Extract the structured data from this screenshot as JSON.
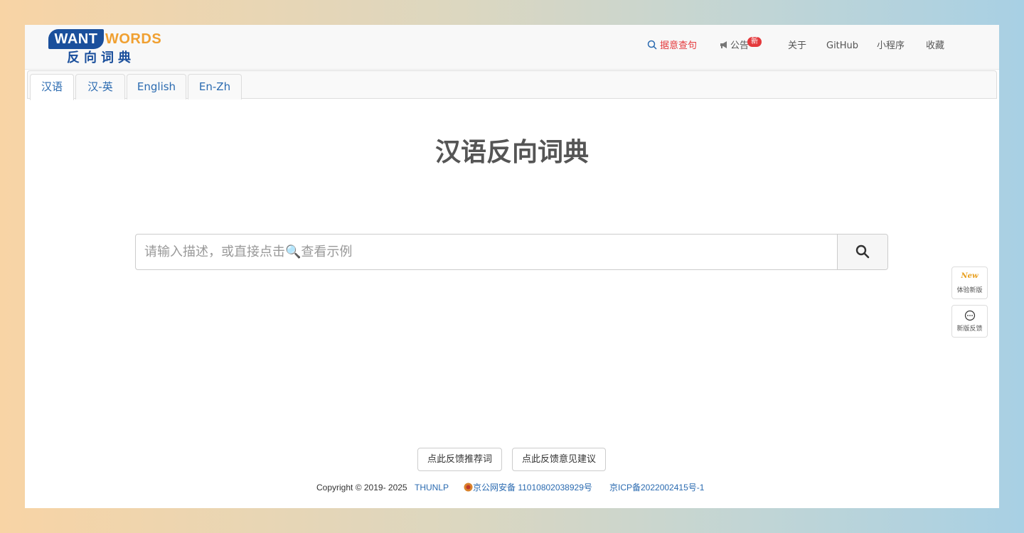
{
  "logo": {
    "want": "WANT",
    "words": "WORDS",
    "cn": "反向词典"
  },
  "nav": {
    "search_label": "据意查句",
    "announce_label": "公告",
    "announce_badge": "新",
    "about": "关于",
    "github": "GitHub",
    "miniprogram": "小程序",
    "favorite": "收藏"
  },
  "tabs": [
    {
      "label": "汉语",
      "active": true
    },
    {
      "label": "汉-英",
      "active": false
    },
    {
      "label": "English",
      "active": false
    },
    {
      "label": "En-Zh",
      "active": false
    }
  ],
  "main": {
    "title": "汉语反向词典",
    "search_placeholder": "请输入描述，或直接点击🔍查看示例",
    "search_value": ""
  },
  "side": {
    "new_mark": "New",
    "try_new": "体验新版",
    "feedback_new": "新版反馈"
  },
  "footer": {
    "btn_recommend": "点此反馈推荐词",
    "btn_suggest": "点此反馈意见建议",
    "copyright": "Copyright © 2019- 2025",
    "org": "THUNLP",
    "police": "京公网安备 11010802038929号",
    "icp": "京ICP备2022002415号-1"
  },
  "colors": {
    "accent": "#e4393c",
    "brand_blue": "#1a4f9c",
    "brand_orange": "#f0a031",
    "link": "#2a6ab0"
  }
}
